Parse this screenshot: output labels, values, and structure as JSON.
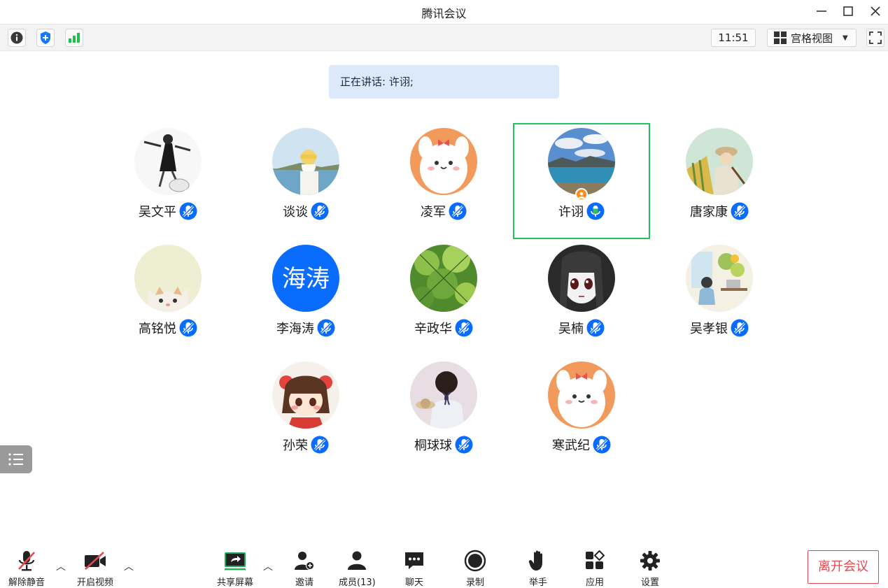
{
  "window": {
    "title": "腾讯会议"
  },
  "toolbar": {
    "clock": "11:51",
    "view_label": "宫格视图",
    "icons": [
      "info-icon",
      "shield-icon",
      "signal-icon",
      "grid-icon",
      "fullscreen-icon"
    ]
  },
  "speaking_banner": "正在讲话: 许诩;",
  "participants": [
    {
      "name": "吴文平",
      "mic": "muted",
      "avatar": "figure-walking"
    },
    {
      "name": "谈谈",
      "mic": "muted",
      "avatar": "girl-seaside"
    },
    {
      "name": "凌军",
      "mic": "muted",
      "avatar": "cartoon-bunny"
    },
    {
      "name": "许诩",
      "mic": "speaking",
      "avatar": "lake-landscape",
      "active": true,
      "host": true
    },
    {
      "name": "唐家康",
      "mic": "muted",
      "avatar": "painter-sketch"
    },
    {
      "name": "高铭悦",
      "mic": "muted",
      "avatar": "cat-peek"
    },
    {
      "name": "李海涛",
      "mic": "muted",
      "avatar": "text-avatar",
      "avatar_text": "海涛"
    },
    {
      "name": "辛政华",
      "mic": "muted",
      "avatar": "green-leaves"
    },
    {
      "name": "吴楠",
      "mic": "muted",
      "avatar": "anime-girl"
    },
    {
      "name": "吴孝银",
      "mic": "muted",
      "avatar": "illustration-cafe"
    },
    {
      "name": "孙荣",
      "mic": "muted",
      "avatar": "cartoon-girl"
    },
    {
      "name": "桐球球",
      "mic": "muted",
      "avatar": "girl-back"
    },
    {
      "name": "寒武纪",
      "mic": "muted",
      "avatar": "cartoon-bunny"
    }
  ],
  "bottom": {
    "unmute": "解除静音",
    "start_video": "开启视频",
    "share_screen": "共享屏幕",
    "invite": "邀请",
    "members": "成员(13)",
    "chat": "聊天",
    "record": "录制",
    "raise_hand": "举手",
    "apps": "应用",
    "settings": "设置",
    "leave": "离开会议"
  },
  "colors": {
    "accent_blue": "#0a6cff",
    "active_border": "#22c262",
    "speaking_green": "#2cc55a",
    "leave_red": "#e5484d",
    "banner_bg": "#dbe9fb"
  }
}
